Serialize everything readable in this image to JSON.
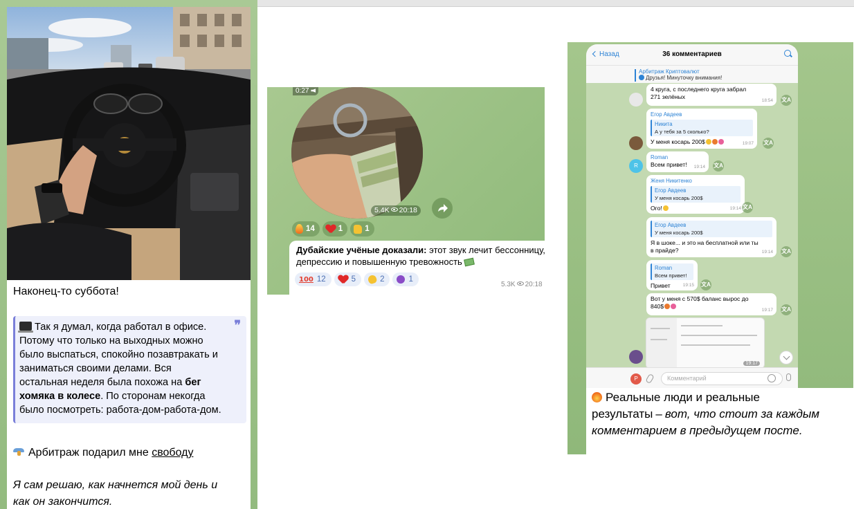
{
  "card1": {
    "title": "Наконец-то суббота!",
    "quote": {
      "line1": "Так я думал, когда работал в офисе.",
      "line2": "Потому что только на выходных можно",
      "line3": "было выспаться, спокойно позавтракать и",
      "line4": "заниматься своими делами. Вся",
      "line5": "остальная неделя была похожа на",
      "bold1": "бег",
      "bold2": "хомяка в колесе",
      "after_bold": ". По сторонам некогда",
      "line7": "было посмотреть: работа-дом-работа-дом.",
      "quote_mark": "❞"
    },
    "line3_prefix": "Арбитраж подарил мне",
    "line3_link": "свободу",
    "italic_line1": "Я сам решаю, как начнется мой день и",
    "italic_line2": "как он закончится."
  },
  "card2": {
    "video_duration": "0:27",
    "video_views": "5.4K",
    "video_time": "20:18",
    "reactions": [
      {
        "count": "14"
      },
      {
        "count": "1"
      },
      {
        "count": "1"
      }
    ],
    "message_bold": "Дубайские учёные доказали:",
    "message_rest1": "этот звук лечит бессонницу,",
    "message_rest2": "депрессию и повышенную тревожность",
    "msg_reactions": [
      {
        "count": "12"
      },
      {
        "count": "5"
      },
      {
        "count": "2"
      },
      {
        "count": "1"
      }
    ],
    "hundred_glyph": "100",
    "msg_views": "5.3K",
    "msg_time": "20:18"
  },
  "card3": {
    "back": "Назад",
    "title": "36 комментариев",
    "pinned_channel": "Арбитраж Криптовалют",
    "pinned_msg": "Друзья! Минуточку внимания!",
    "messages": [
      {
        "text1": "4 круга, с последнего круга забрал",
        "text2": "271 зелёных",
        "time": "18:54"
      },
      {
        "name": "Егор Авдеев",
        "reply_name": "Никита",
        "reply_text": "А у тебя за 5 сколько?",
        "text": "У меня косарь 200$",
        "time": "19:07"
      },
      {
        "name": "Roman",
        "text": "Всем привет!",
        "time": "19:14"
      },
      {
        "name": "Женя Никитенко",
        "reply_name": "Егор Авдеев",
        "reply_text": "У меня косарь 200$",
        "text": "Ого!",
        "time": "19:14"
      },
      {
        "reply_name": "Егор Авдеев",
        "reply_text": "У меня косарь 200$",
        "text1": "Я в шоке... и это на бесплатной или ты",
        "text2": "в прайде?",
        "time": "19:14"
      },
      {
        "reply_name": "Roman",
        "reply_text": "Всем привет!",
        "text": "Привет",
        "time": "19:15"
      },
      {
        "text1": "Вот у меня с 570$ баланс вырос до",
        "text2": "840$",
        "time": "19:17"
      },
      {
        "time": "19:17"
      }
    ],
    "avatar_letter": "R",
    "input_avatar": "P",
    "input_placeholder": "Комментарий",
    "translate_glyph": "文A",
    "bottom_bold": "Реальные люди и реальные",
    "bottom_bold2": "результаты",
    "bottom_dash": "–",
    "bottom_italic1": "вот, что стоит за каждым",
    "bottom_italic2": "комментарием в предыдущем посте."
  }
}
